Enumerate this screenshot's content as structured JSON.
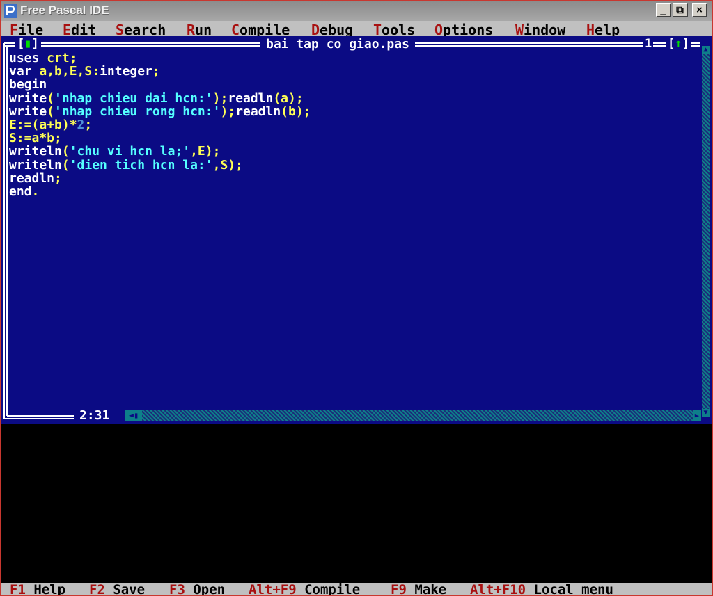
{
  "app": {
    "title": "Free Pascal IDE",
    "icon": "free-pascal-icon"
  },
  "window_controls": {
    "minimize": "_",
    "restore": "⧉",
    "close": "×"
  },
  "menu": [
    {
      "hotkey": "F",
      "rest": "ile"
    },
    {
      "hotkey": "E",
      "rest": "dit"
    },
    {
      "hotkey": "S",
      "rest": "earch"
    },
    {
      "hotkey": "R",
      "rest": "un"
    },
    {
      "hotkey": "C",
      "rest": "ompile"
    },
    {
      "hotkey": "D",
      "rest": "ebug"
    },
    {
      "hotkey": "T",
      "rest": "ools"
    },
    {
      "hotkey": "O",
      "rest": "ptions"
    },
    {
      "hotkey": "W",
      "rest": "indow"
    },
    {
      "hotkey": "H",
      "rest": "elp"
    }
  ],
  "editor": {
    "file_name": "bai tap co giao.pas",
    "close_box": {
      "open": "[",
      "mark": "▮",
      "close": "]"
    },
    "window_number": "1",
    "zoom_box": {
      "open": "[",
      "mark": "↑",
      "close": "]"
    },
    "cursor_position": "2:31",
    "code_lines": [
      [
        {
          "t": "uses ",
          "c": "w"
        },
        {
          "t": "crt;",
          "c": "y"
        }
      ],
      [
        {
          "t": "var ",
          "c": "w"
        },
        {
          "t": "a,b,E,S:",
          "c": "y"
        },
        {
          "t": "integer",
          "c": "w"
        },
        {
          "t": ";",
          "c": "y"
        }
      ],
      [
        {
          "t": "begin",
          "c": "w"
        }
      ],
      [
        {
          "t": "write",
          "c": "w"
        },
        {
          "t": "(",
          "c": "y"
        },
        {
          "t": "'nhap chieu dai hcn:'",
          "c": "c"
        },
        {
          "t": ");",
          "c": "y"
        },
        {
          "t": "readln",
          "c": "w"
        },
        {
          "t": "(a);",
          "c": "y"
        }
      ],
      [
        {
          "t": "write",
          "c": "w"
        },
        {
          "t": "(",
          "c": "y"
        },
        {
          "t": "'nhap chieu rong hcn:'",
          "c": "c"
        },
        {
          "t": ");",
          "c": "y"
        },
        {
          "t": "readln",
          "c": "w"
        },
        {
          "t": "(b);",
          "c": "y"
        }
      ],
      [
        {
          "t": "E:=(a+b)*",
          "c": "y"
        },
        {
          "t": "2",
          "c": "n"
        },
        {
          "t": ";",
          "c": "y"
        }
      ],
      [
        {
          "t": "S:=a*b;",
          "c": "y"
        }
      ],
      [
        {
          "t": "writeln",
          "c": "w"
        },
        {
          "t": "(",
          "c": "y"
        },
        {
          "t": "'chu vi hcn la;'",
          "c": "c"
        },
        {
          "t": ",E);",
          "c": "y"
        }
      ],
      [
        {
          "t": "writeln",
          "c": "w"
        },
        {
          "t": "(",
          "c": "y"
        },
        {
          "t": "'dien tich hcn la:'",
          "c": "c"
        },
        {
          "t": ",S);",
          "c": "y"
        }
      ],
      [
        {
          "t": "readln",
          "c": "w"
        },
        {
          "t": ";",
          "c": "y"
        }
      ],
      [
        {
          "t": "end",
          "c": "w"
        },
        {
          "t": ".",
          "c": "y"
        }
      ]
    ]
  },
  "scrollbars": {
    "up_arrow": "▲",
    "down_arrow": "▼",
    "left_thumb": "◄▮",
    "right_arrow": "►"
  },
  "status_bar": [
    {
      "key": "F1",
      "label": "Help"
    },
    {
      "key": "F2",
      "label": "Save"
    },
    {
      "key": "F3",
      "label": "Open"
    },
    {
      "key": "Alt+F9",
      "label": "Compile"
    },
    {
      "key": "F9",
      "label": "Make"
    },
    {
      "key": "Alt+F10",
      "label": "Local menu"
    }
  ],
  "colors": {
    "editor_bg": "#0b0b84",
    "menu_bg": "#c0c0c0",
    "hotkey": "#a81010",
    "keyword": "#ffffff",
    "symbol": "#ffff55",
    "string": "#55ffff",
    "number": "#4f8fd6",
    "output_bg": "#000000"
  }
}
